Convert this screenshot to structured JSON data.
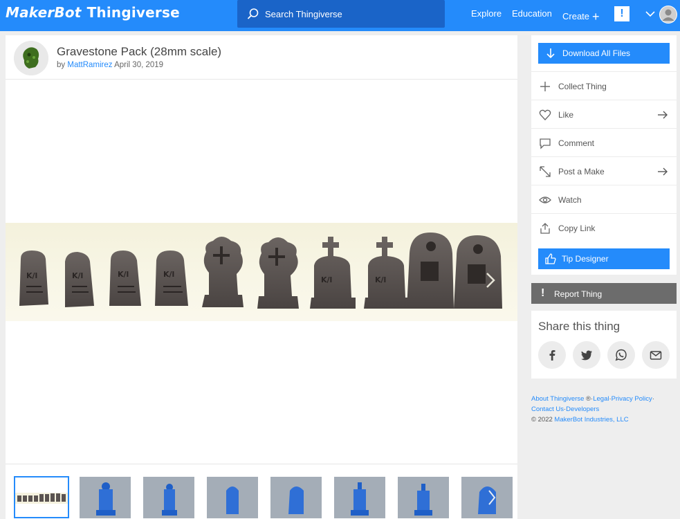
{
  "colors": {
    "brand": "#248bfb",
    "search_bg": "#1a64c8",
    "report_bg": "#6c6c6c"
  },
  "topbar": {
    "logo_part1": "MakerBot",
    "logo_part2": "Thingiverse",
    "search_placeholder": "Search Thingiverse",
    "nav": {
      "explore": "Explore",
      "education": "Education",
      "create": "Create"
    },
    "alert_label": "!"
  },
  "thing": {
    "title": "Gravestone Pack (28mm scale)",
    "by": "by",
    "author": "MattRamirez",
    "date": "April 30, 2019"
  },
  "gallery": {
    "thumbnail_count": 8,
    "selected_index": 0
  },
  "sidebar": {
    "download": "Download All Files",
    "collect": "Collect Thing",
    "like": "Like",
    "comment": "Comment",
    "post_make": "Post a Make",
    "watch": "Watch",
    "copy_link": "Copy Link",
    "tip": "Tip Designer"
  },
  "report": {
    "label": "Report Thing",
    "icon": "!"
  },
  "share": {
    "title": "Share this thing",
    "icons": [
      "facebook-icon",
      "twitter-icon",
      "whatsapp-icon",
      "email-icon"
    ]
  },
  "footer": {
    "about": "About Thingiverse",
    "reg": "®",
    "legal": "Legal",
    "privacy": "Privacy Policy",
    "contact": "Contact Us",
    "developers": "Developers",
    "copyright": "©  2022",
    "company": "MakerBot Industries, LLC"
  }
}
